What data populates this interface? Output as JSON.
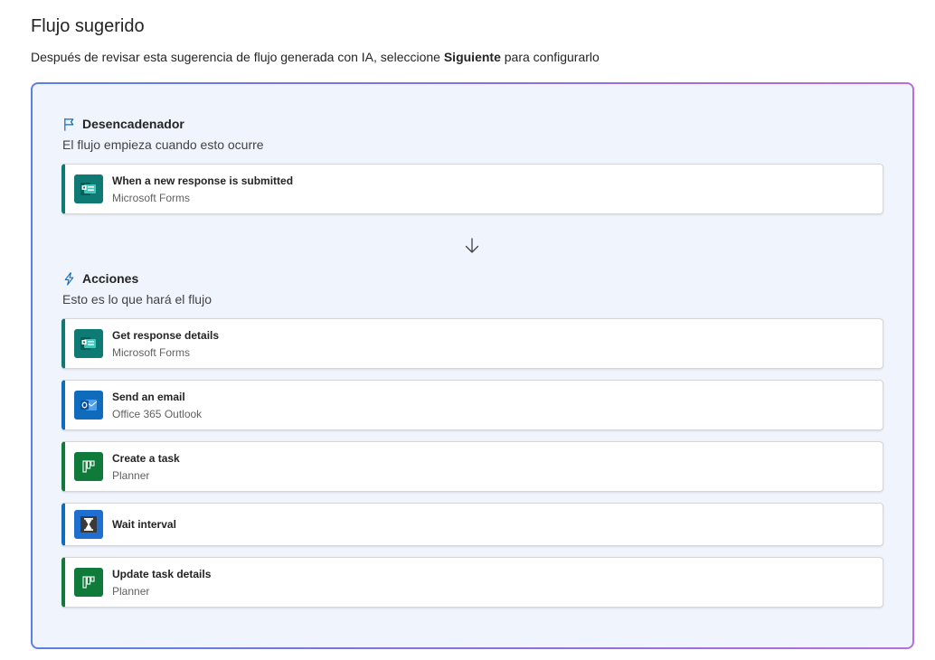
{
  "header": {
    "title": "Flujo sugerido",
    "subtitle_before": "Después de revisar esta sugerencia de flujo generada con IA, seleccione ",
    "subtitle_bold": "Siguiente",
    "subtitle_after": " para configurarlo"
  },
  "trigger_section": {
    "icon": "flag-icon",
    "title": "Desencadenador",
    "description": "El flujo empieza cuando esto ocurre",
    "card": {
      "title": "When a new response is submitted",
      "connector": "Microsoft Forms",
      "icon": "microsoft-forms-icon",
      "color": "#0e7a74"
    }
  },
  "actions_section": {
    "icon": "lightning-icon",
    "title": "Acciones",
    "description": "Esto es lo que hará el flujo",
    "cards": [
      {
        "title": "Get response details",
        "connector": "Microsoft Forms",
        "icon": "microsoft-forms-icon",
        "color": "#0e7a74"
      },
      {
        "title": "Send an email",
        "connector": "Office 365 Outlook",
        "icon": "outlook-icon",
        "color": "#0f6cbd"
      },
      {
        "title": "Create a task",
        "connector": "Planner",
        "icon": "planner-icon",
        "color": "#0f7a3a"
      },
      {
        "title": "Wait interval",
        "connector": "",
        "icon": "hourglass-icon",
        "color": "#1f6fd1"
      },
      {
        "title": "Update task details",
        "connector": "Planner",
        "icon": "planner-icon",
        "color": "#0f7a3a"
      }
    ]
  },
  "colors": {
    "accent_blue": "#0f6cbd",
    "frame_gradient_start": "#5b7ee8",
    "frame_gradient_end": "#b86ddb",
    "panel_background": "#f0f4fd"
  }
}
